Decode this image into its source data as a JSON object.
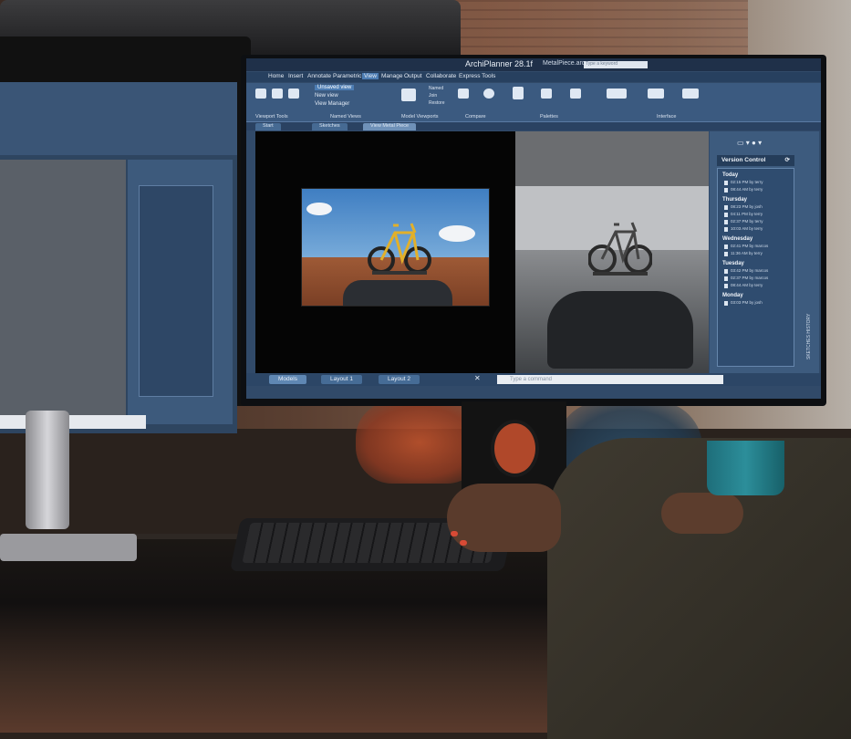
{
  "app": {
    "title": "ArchiPlanner 28.1f",
    "document": "MetalPiece.arc",
    "search_placeholder": "Type a keyword"
  },
  "menu": [
    "Home",
    "Insert",
    "Annotate",
    "Parametric",
    "View",
    "Manage",
    "Output",
    "Collaborate",
    "Express Tools"
  ],
  "menu_active": "View",
  "ribbon": {
    "view_dropdown": [
      "Unsaved view",
      "New view",
      "View Manager"
    ],
    "named_items": [
      "Named",
      "Join",
      "Restore"
    ],
    "groups": [
      "Viewport Tools",
      "Named Views",
      "Model Viewports",
      "Compare",
      "Palettes",
      "Interface"
    ]
  },
  "doc_tabs": [
    "Start",
    "Sketches",
    "View Metal Piece"
  ],
  "layout_tabs": [
    "Models",
    "Layout 1",
    "Layout 2"
  ],
  "command_placeholder": "Type a command",
  "version_control": {
    "title": "Version Control",
    "side_label": "SKETCHES HISTORY",
    "days": [
      {
        "day": "Today",
        "items": [
          "02:15 PM by terry",
          "08:44 AM by terry"
        ]
      },
      {
        "day": "Thursday",
        "items": [
          "08:23 PM by josh",
          "04:11 PM by terry",
          "02:37 PM by terry",
          "10:03 AM by terry"
        ]
      },
      {
        "day": "Wednesday",
        "items": [
          "02:41 PM by marcos",
          "11:36 AM by terry"
        ]
      },
      {
        "day": "Tuesday",
        "items": [
          "03:42 PM by marcos",
          "02:37 PM by marcos",
          "08:44 AM by terry"
        ]
      },
      {
        "day": "Monday",
        "items": [
          "03:03 PM by josh"
        ]
      }
    ]
  },
  "colors": {
    "ui_blue": "#3b5a80",
    "ui_dark": "#1f3049",
    "accent": "#4d7db3"
  }
}
